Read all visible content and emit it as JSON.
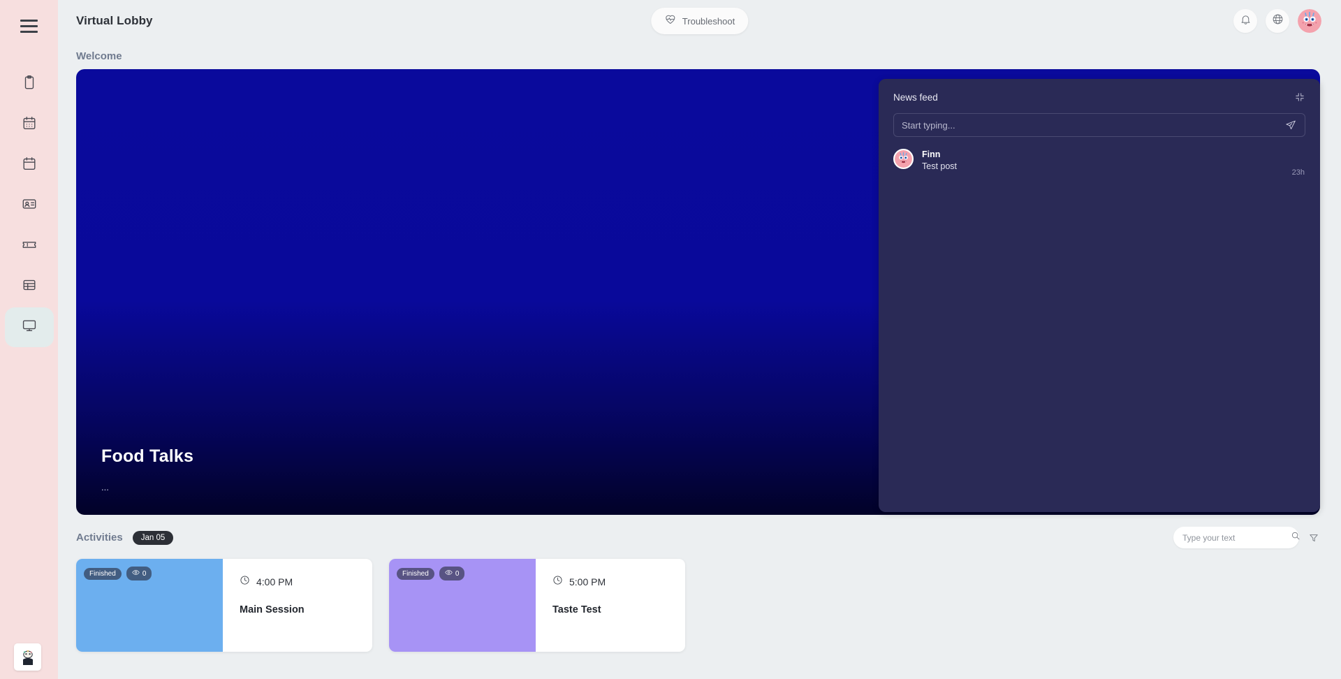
{
  "sidebar": {
    "menu_label": "Menu",
    "items": [
      {
        "icon": "clipboard-icon",
        "name": "sidebar-item-clipboard",
        "active": false
      },
      {
        "icon": "calendar-grid-icon",
        "name": "sidebar-item-agenda",
        "active": false
      },
      {
        "icon": "calendar-icon",
        "name": "sidebar-item-schedule",
        "active": false
      },
      {
        "icon": "id-badge-icon",
        "name": "sidebar-item-attendees",
        "active": false
      },
      {
        "icon": "ticket-icon",
        "name": "sidebar-item-tickets",
        "active": false
      },
      {
        "icon": "table-icon",
        "name": "sidebar-item-reports",
        "active": false
      },
      {
        "icon": "monitor-icon",
        "name": "sidebar-item-virtual-lobby",
        "active": true
      }
    ],
    "widget_icon": "assistant-widget-icon"
  },
  "header": {
    "title": "Virtual Lobby",
    "troubleshoot_label": "Troubleshoot",
    "troubleshoot_icon": "heart-pulse-icon",
    "notifications_icon": "bell-icon",
    "language_icon": "globe-icon",
    "avatar_name": "user-avatar"
  },
  "welcome": {
    "section_label": "Welcome"
  },
  "hero": {
    "title": "Food Talks",
    "subtitle": "...",
    "gradient_top": "#0a0a9c",
    "gradient_bottom": "#020228"
  },
  "news_feed": {
    "title": "News feed",
    "collapse_icon": "collapse-icon",
    "input_placeholder": "Start typing...",
    "input_value": "",
    "send_icon": "send-icon",
    "posts": [
      {
        "author": "Finn",
        "content": "Test post",
        "time": "23h",
        "avatar": "finn-avatar"
      }
    ]
  },
  "activities": {
    "title": "Activities",
    "date_chip": "Jan 05",
    "search_placeholder": "Type your text",
    "search_value": "",
    "search_icon": "search-icon",
    "filter_icon": "filter-icon",
    "cards": [
      {
        "status": "Finished",
        "views": "0",
        "time": "4:00 PM",
        "title": "Main Session",
        "thumb_color": "#6cafef"
      },
      {
        "status": "Finished",
        "views": "0",
        "time": "5:00 PM",
        "title": "Taste Test",
        "thumb_color": "#a793f5"
      }
    ]
  }
}
